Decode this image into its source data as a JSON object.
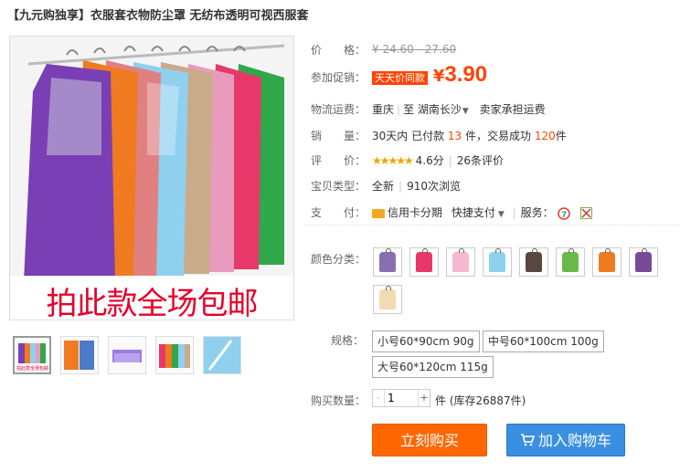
{
  "title": "【九元购独享】衣服套衣物防尘罩 无纺布透明可视西服套",
  "main_image": {
    "promo_text": "拍此款全场包邮"
  },
  "thumbnail_text": "拍此款全场包邮",
  "price": {
    "label": "价　　格：",
    "original": "¥ 24.60 - 27.60"
  },
  "promotion": {
    "label": "参加促销：",
    "tag": "天天价同款",
    "currency": "¥",
    "amount": "3.90"
  },
  "shipping": {
    "label": "物流运费：",
    "from": "重庆",
    "to_prefix": "至",
    "to": "湖南长沙",
    "fee": "卖家承担运费"
  },
  "sales": {
    "label": "销　　量：",
    "prefix": "30天内 已付款",
    "paid": "13",
    "unit1": "件，交易成功",
    "success": "120",
    "unit2": "件"
  },
  "rating": {
    "label": "评　　价：",
    "stars": "★★★★★",
    "score": "4.6分",
    "reviews": "26条评价"
  },
  "condition": {
    "label": "宝贝类型：",
    "value": "全新",
    "views": "910次浏览"
  },
  "payment": {
    "label": "支　　付：",
    "credit": "信用卡分期",
    "quick": "快捷支付",
    "service_label": "服务："
  },
  "color": {
    "label": "颜色分类：",
    "swatches": [
      {
        "color": "#8a6fb0"
      },
      {
        "color": "#e8386a"
      },
      {
        "color": "#f6b8cf"
      },
      {
        "color": "#8fd0ef"
      },
      {
        "color": "#5a4640"
      },
      {
        "color": "#6ab84a"
      },
      {
        "color": "#f07a1f"
      },
      {
        "color": "#7a4a9a"
      },
      {
        "color": "#f0dcb0"
      }
    ]
  },
  "size": {
    "label": "规格：",
    "options": [
      "小号60*90cm 90g",
      "中号60*100cm 100g",
      "大号60*120cm 115g"
    ]
  },
  "quantity": {
    "label": "购买数量：",
    "value": "1",
    "stock": "件 (库存26887件)",
    "minus": "-",
    "plus": "+"
  },
  "buttons": {
    "buy_now": "立刻购买",
    "add_cart": "加入购物车"
  }
}
